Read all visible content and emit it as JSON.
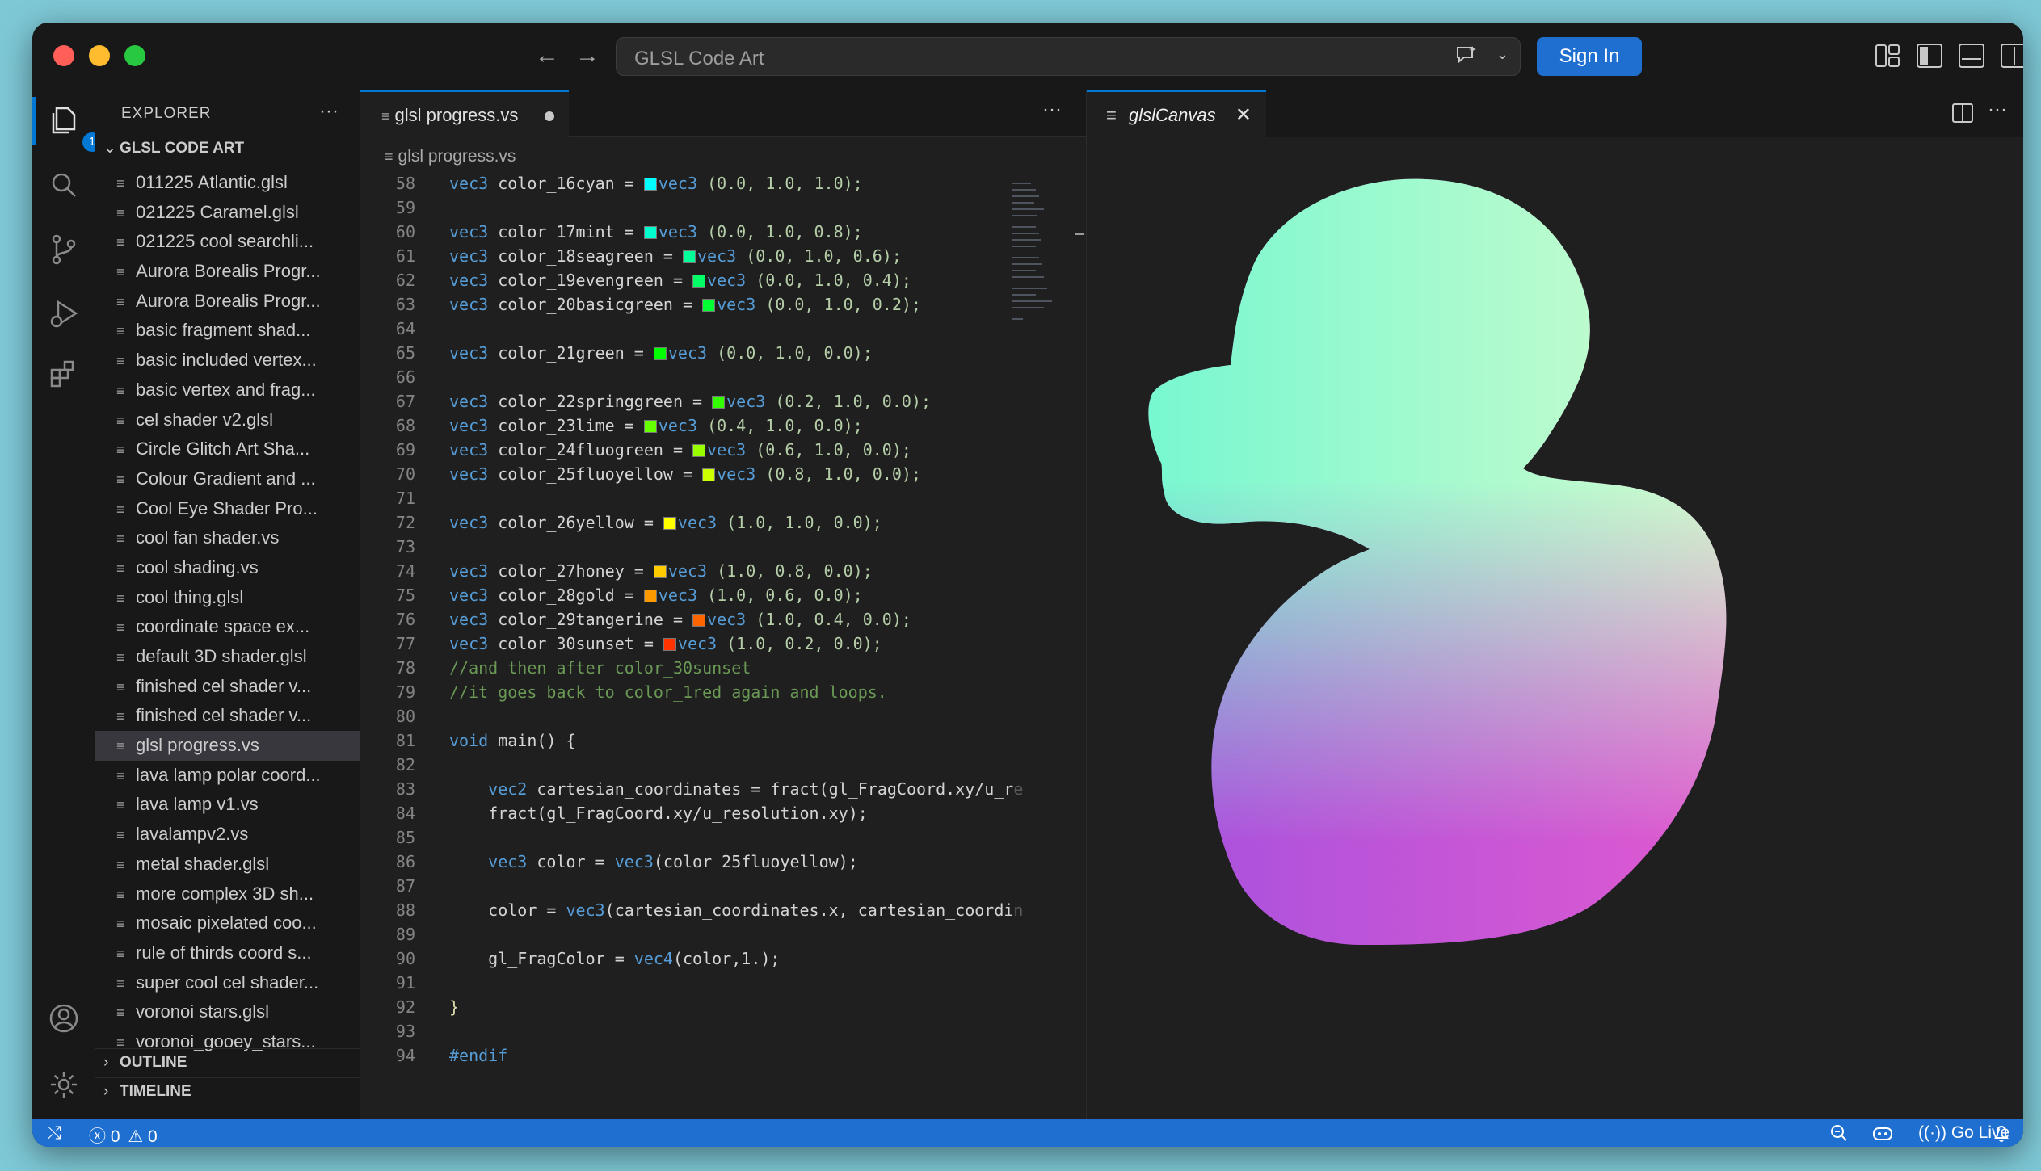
{
  "titlebar": {
    "search_label": "GLSL Code Art",
    "signin_label": "Sign In",
    "back_icon": "←",
    "forward_icon": "→"
  },
  "activity": {
    "explorer_badge": "1"
  },
  "sidebar": {
    "title": "EXPLORER",
    "more": "···",
    "folder": "GLSL CODE ART",
    "files": [
      "011225 Atlantic.glsl",
      "021225 Caramel.glsl",
      "021225 cool searchli...",
      "Aurora Borealis Progr...",
      "Aurora Borealis Progr...",
      "basic fragment shad...",
      "basic included vertex...",
      "basic vertex and frag...",
      "cel shader v2.glsl",
      "Circle Glitch Art Sha...",
      "Colour Gradient and ...",
      "Cool Eye Shader Pro...",
      "cool fan shader.vs",
      "cool shading.vs",
      "cool thing.glsl",
      "coordinate space ex...",
      "default 3D shader.glsl",
      "finished cel shader v...",
      "finished cel shader v...",
      "glsl progress.vs",
      "lava lamp polar coord...",
      "lava lamp v1.vs",
      "lavalampv2.vs",
      "metal shader.glsl",
      "more complex 3D sh...",
      "mosaic pixelated coo...",
      "rule of thirds coord s...",
      "super cool cel shader...",
      "voronoi stars.glsl",
      "voronoi_gooey_stars..."
    ],
    "selected_index": 19,
    "outline": "OUTLINE",
    "timeline": "TIMELINE"
  },
  "editor": {
    "tab_label": "glsl progress.vs",
    "tab_more": "···",
    "breadcrumb": "glsl progress.vs",
    "lines": [
      {
        "n": "58",
        "code": "c16",
        "text": ""
      },
      {
        "n": "59",
        "text": ""
      },
      {
        "n": "60"
      },
      {
        "n": "61"
      },
      {
        "n": "62"
      },
      {
        "n": "63"
      },
      {
        "n": "64"
      },
      {
        "n": "65"
      },
      {
        "n": "66"
      },
      {
        "n": "67"
      },
      {
        "n": "68"
      },
      {
        "n": "69"
      },
      {
        "n": "70"
      },
      {
        "n": "71"
      },
      {
        "n": "72"
      },
      {
        "n": "73"
      },
      {
        "n": "74"
      },
      {
        "n": "75"
      },
      {
        "n": "76"
      },
      {
        "n": "77"
      },
      {
        "n": "78"
      },
      {
        "n": "79"
      },
      {
        "n": "80"
      },
      {
        "n": "81"
      },
      {
        "n": "82"
      },
      {
        "n": "83"
      },
      {
        "n": "84"
      },
      {
        "n": "85"
      },
      {
        "n": "86"
      },
      {
        "n": "87"
      },
      {
        "n": "88"
      },
      {
        "n": "89"
      },
      {
        "n": "90"
      },
      {
        "n": "91"
      },
      {
        "n": "92"
      },
      {
        "n": "93"
      },
      {
        "n": "94"
      }
    ],
    "code": {
      "l58_var": "color_16cyan",
      "l58_vals": "(0.0, 1.0, 1.0);",
      "l60_var": "color_17mint",
      "l60_vals": "(0.0, 1.0, 0.8);",
      "l61_var": "color_18seagreen",
      "l61_vals": "(0.0, 1.0, 0.6);",
      "l62_var": "color_19evengreen",
      "l62_vals": "(0.0, 1.0, 0.4);",
      "l63_var": "color_20basicgreen",
      "l63_vals": "(0.0, 1.0, 0.2);",
      "l65_var": "color_21green",
      "l65_vals": "(0.0, 1.0, 0.0);",
      "l67_var": "color_22springgreen",
      "l67_vals": "(0.2, 1.0, 0.0);",
      "l68_var": "color_23lime",
      "l68_vals": "(0.4, 1.0, 0.0);",
      "l69_var": "color_24fluogreen",
      "l69_vals": "(0.6, 1.0, 0.0);",
      "l70_var": "color_25fluoyellow",
      "l70_vals": "(0.8, 1.0, 0.0);",
      "l72_var": "color_26yellow",
      "l72_vals": "(1.0, 1.0, 0.0);",
      "l74_var": "color_27honey",
      "l74_vals": "(1.0, 0.8, 0.0);",
      "l75_var": "color_28gold",
      "l75_vals": "(1.0, 0.6, 0.0);",
      "l76_var": "color_29tangerine",
      "l76_vals": "(1.0, 0.4, 0.0);",
      "l77_var": "color_30sunset",
      "l77_vals": "(1.0, 0.2, 0.0);",
      "l78": "//and then after color_30sunset",
      "l79": "//it goes back to color_1red again and loops.",
      "l81_kw": "void",
      "l81_rest": " main() {",
      "l83_kw": "vec2",
      "l83_rest": " cartesian_coordinates = fract(gl_FragCoord.xy/u_r",
      "l83_fade": "esolu",
      "l84": "fract(gl_FragCoord.xy/u_resolution.xy);",
      "l86_kw": "vec3",
      "l86_rest1": " color = ",
      "l86_kw2": "vec3",
      "l86_rest2": "(color_25fluoyellow);",
      "l88_rest1": "color = ",
      "l88_kw": "vec3",
      "l88_rest2": "(cartesian_coordinates.x, cartesian_coordi",
      "l88_fade": "nates.",
      "l90_rest1": "gl_FragColor = ",
      "l90_kw": "vec4",
      "l90_rest2": "(color,1.);",
      "l92": "}",
      "l94": "#endif"
    },
    "swatches": {
      "l58": "#00ffff",
      "l60": "#00ffcc",
      "l61": "#00ff99",
      "l62": "#00ff66",
      "l63": "#00ff33",
      "l65": "#00ff00",
      "l67": "#33ff00",
      "l68": "#66ff00",
      "l69": "#99ff00",
      "l70": "#ccff00",
      "l72": "#ffff00",
      "l74": "#ffcc00",
      "l75": "#ff9900",
      "l76": "#ff6600",
      "l77": "#ff3300"
    }
  },
  "preview": {
    "tab_label": "glslCanvas",
    "close": "✕",
    "more": "···",
    "gradient": {
      "top_left": "#6ef7d0",
      "top_right": "#ffffcc",
      "bottom_left": "#a050e0",
      "bottom_right": "#ff5ec8"
    }
  },
  "statusbar": {
    "errors": "0",
    "warnings": "0",
    "golive": "Go Live"
  },
  "colors": {
    "accent": "#1f6fd0",
    "tab_accent": "#0078d4"
  }
}
